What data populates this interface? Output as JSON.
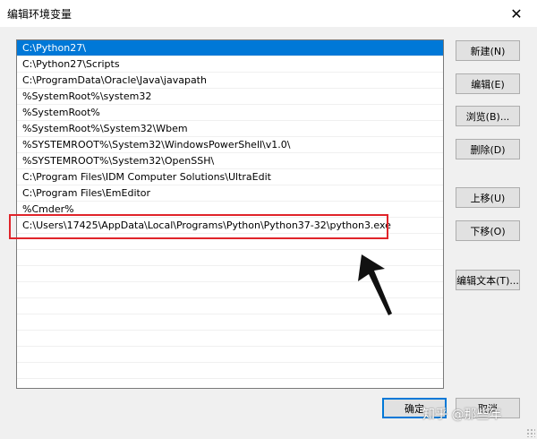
{
  "window": {
    "title": "编辑环境变量",
    "close_glyph": "✕"
  },
  "list": {
    "items": [
      "C:\\Python27\\",
      "C:\\Python27\\Scripts",
      "C:\\ProgramData\\Oracle\\Java\\javapath",
      "%SystemRoot%\\system32",
      "%SystemRoot%",
      "%SystemRoot%\\System32\\Wbem",
      "%SYSTEMROOT%\\System32\\WindowsPowerShell\\v1.0\\",
      "%SYSTEMROOT%\\System32\\OpenSSH\\",
      "C:\\Program Files\\IDM Computer Solutions\\UltraEdit",
      "C:\\Program Files\\EmEditor",
      "%Cmder%",
      "C:\\Users\\17425\\AppData\\Local\\Programs\\Python\\Python37-32\\python3.exe"
    ],
    "selected_index": 0
  },
  "buttons": {
    "new": "新建(N)",
    "edit": "编辑(E)",
    "browse": "浏览(B)...",
    "delete": "删除(D)",
    "move_up": "上移(U)",
    "move_down": "下移(O)",
    "edit_text": "编辑文本(T)...",
    "ok": "确定",
    "cancel": "取消"
  },
  "annotation": {
    "highlight_color": "#e0242a",
    "arrow_color": "#111111"
  },
  "watermark": "知乎 @那些年"
}
